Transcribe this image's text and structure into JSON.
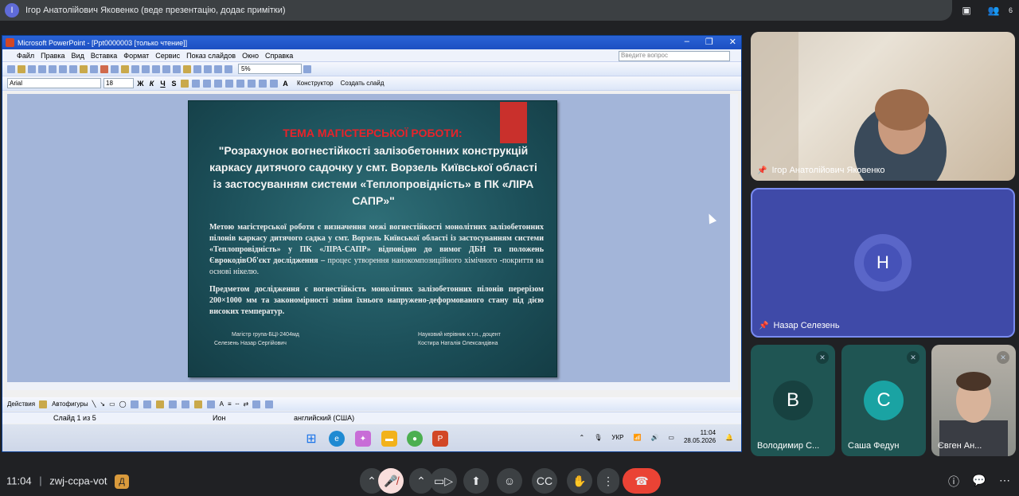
{
  "top_bar": {
    "avatar_letter": "І",
    "presenter_text": "Ігор Анатолійович Яковенко (веде презентацію, додає примітки)",
    "participant_count": "6"
  },
  "ppt": {
    "window_title": "Microsoft PowerPoint - [Ppt0000003 [только чтение]]",
    "menu": [
      "Файл",
      "Правка",
      "Вид",
      "Вставка",
      "Формат",
      "Сервис",
      "Показ слайдов",
      "Окно",
      "Справка"
    ],
    "ask_placeholder": "Введите вопрос",
    "zoom": "5%",
    "font_name": "Arial",
    "font_size": "18",
    "designer_label": "Конструктор",
    "new_slide_label": "Создать слайд",
    "slide": {
      "topic": "ТЕМА МАГІСТЕРСЬКОЇ РОБОТИ:",
      "title": "\"Розрахунок вогнестійкості залізобетонних конструкцій каркасу дитячого садочку у смт. Ворзель Київської області із застосуванням системи «Теплопровідність» в ПК «ЛІРА САПР»\"",
      "para1_bold": "Метою магістерської роботи є визначення межі вогнестійкості монолітних залізобетонних пілонів каркасу дитячого садка у смт. Ворзель Київської області із застосуванням системи «Теплопровідність» у ПК «ЛІРА-САПР» відповідно до вимог ДБН та положень ЄврокодівОб'єкт дослідження –",
      "para1_rest": " процес утворення нанокомпозиційного хімічного -покриття на основі нікелю.",
      "para2": "Предметом дослідження є вогнестійкість монолітних залізобетонних пілонів перерізом 200×1000 мм та закономірності зміни їхнього напружено-деформованого стану під дією високих температур.",
      "sign_left_1": "Магістр група-БЦІ-2404мд",
      "sign_left_2": "Селезень Назар Сергійович",
      "sign_right_1": "Науковий керівник к.т.н., доцент",
      "sign_right_2": "Костира Наталія Олександівна"
    },
    "draw_actions": "Действия",
    "draw_autoshapes": "Автофигуры",
    "status_slide": "Слайд 1 из 5",
    "status_design": "Ион",
    "status_lang": "английский (США)",
    "tray_lang": "УКР",
    "tray_time": "11:04",
    "tray_date": "28.05.2026"
  },
  "tiles": [
    {
      "name": "Ігор Анатолійович Яковенко"
    },
    {
      "name": "Назар Селезень",
      "letter": "Н"
    },
    {
      "name": "Володимир С...",
      "letter": "В"
    },
    {
      "name": "Саша Федун",
      "letter": "С"
    },
    {
      "name": "Євген Ан..."
    }
  ],
  "bottom": {
    "time": "11:04",
    "meeting_code": "zwj-ccpa-vot"
  },
  "colors": {
    "accent_red": "#ea4335",
    "tile_blue": "#3f4aa8",
    "tile_teal": "#1f5553"
  }
}
